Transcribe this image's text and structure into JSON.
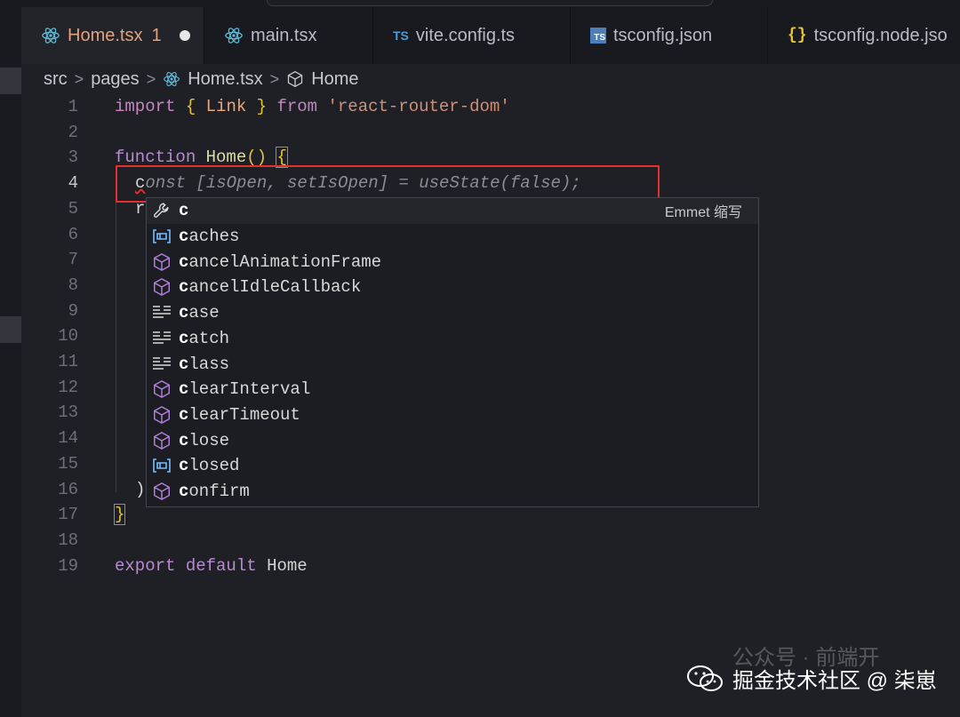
{
  "tabs": [
    {
      "label": "Home.tsx",
      "badge": "1",
      "icon": "react-icon",
      "active": true,
      "modified": true
    },
    {
      "label": "main.tsx",
      "icon": "react-icon"
    },
    {
      "label": "vite.config.ts",
      "icon": "ts-icon",
      "icon_text": "TS"
    },
    {
      "label": "tsconfig.json",
      "icon": "tsconfig-icon",
      "icon_text": "TS"
    },
    {
      "label": "tsconfig.node.jso",
      "icon": "json-braces-icon",
      "icon_text": "{}"
    }
  ],
  "breadcrumb": {
    "items": [
      "src",
      "pages",
      "Home.tsx",
      "Home"
    ],
    "separator": ">"
  },
  "line_numbers": [
    "1",
    "2",
    "3",
    "4",
    "5",
    "6",
    "7",
    "8",
    "9",
    "10",
    "11",
    "12",
    "13",
    "14",
    "15",
    "16",
    "17",
    "18",
    "19"
  ],
  "code": {
    "l1": {
      "import": "import",
      "open": "{",
      "name": "Link",
      "close": "}",
      "from": "from",
      "module": "'react-router-dom'"
    },
    "l3": {
      "function": "function",
      "name": "Home",
      "parens": "()",
      "brace": "{"
    },
    "l4": {
      "typed": "c",
      "ghost": "onst [isOpen, setIsOpen] = useState(false);"
    },
    "l5": {
      "partial": "r"
    },
    "l16": {
      "partial": ")"
    },
    "l17": {
      "brace": "}"
    },
    "l19": {
      "export": "export",
      "default": "default",
      "name": "Home"
    }
  },
  "suggest": {
    "items": [
      {
        "match": "c",
        "rest": "",
        "icon": "wrench-icon",
        "detail": "Emmet 缩写"
      },
      {
        "match": "c",
        "rest": "aches",
        "icon": "variable-icon"
      },
      {
        "match": "c",
        "rest": "ancelAnimationFrame",
        "icon": "method-cube-icon"
      },
      {
        "match": "c",
        "rest": "ancelIdleCallback",
        "icon": "method-cube-icon"
      },
      {
        "match": "c",
        "rest": "ase",
        "icon": "keyword-icon"
      },
      {
        "match": "c",
        "rest": "atch",
        "icon": "keyword-icon"
      },
      {
        "match": "c",
        "rest": "lass",
        "icon": "keyword-icon"
      },
      {
        "match": "c",
        "rest": "learInterval",
        "icon": "method-cube-icon"
      },
      {
        "match": "c",
        "rest": "learTimeout",
        "icon": "method-cube-icon"
      },
      {
        "match": "c",
        "rest": "lose",
        "icon": "method-cube-icon"
      },
      {
        "match": "c",
        "rest": "losed",
        "icon": "variable-icon"
      },
      {
        "match": "c",
        "rest": "onfirm",
        "icon": "method-cube-icon"
      }
    ]
  },
  "watermark": {
    "main": "掘金技术社区 @ 柒崽",
    "faint": "公众号 · 前端开",
    "icon": "wechat-icon"
  },
  "colors": {
    "background": "#1f2026",
    "highlight_box": "#e2302c",
    "keyword": "#c586c0",
    "function": "#dcdcaa",
    "string": "#ce9178",
    "bracket": "#e3c23c",
    "icon_purple": "#b180d7",
    "icon_blue": "#75beff"
  }
}
